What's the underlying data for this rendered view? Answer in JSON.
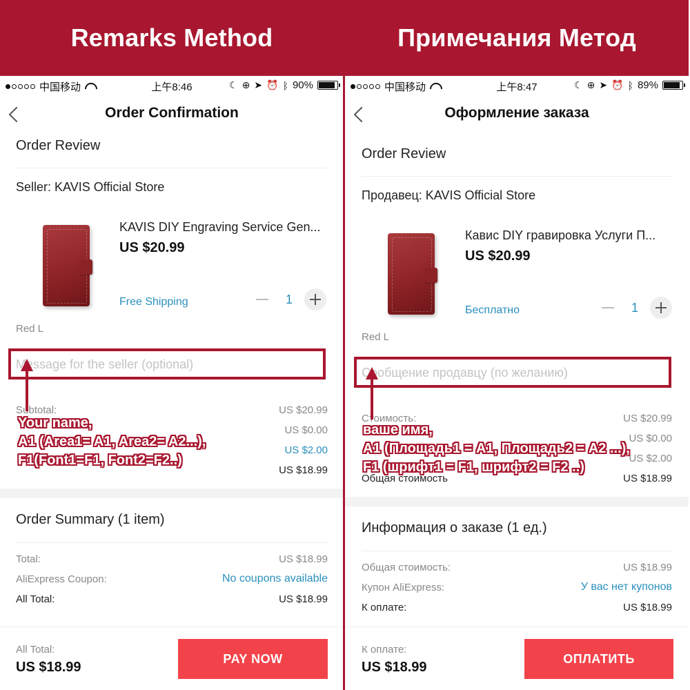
{
  "panels": {
    "left": {
      "banner": "Remarks Method",
      "status": {
        "carrier": "中国移动",
        "time": "上午8:46",
        "battery": "90%",
        "battery_level": 0.9
      },
      "nav_title": "Order Confirmation",
      "order_review": "Order Review",
      "seller_line": "Seller:  KAVIS Official Store",
      "product": {
        "name": "KAVIS DIY Engraving Service Gen...",
        "price": "US $20.99",
        "shipping": "Free Shipping",
        "quantity": "1",
        "variant": "Red L"
      },
      "message_placeholder": "Message for the seller (optional)",
      "costs": [
        {
          "label": "Subtotal:",
          "value": "US $20.99",
          "style": "grey"
        },
        {
          "label": "",
          "value": "US $0.00",
          "style": "grey"
        },
        {
          "label": "",
          "value": "US $2.00",
          "style": "blue"
        },
        {
          "label": "",
          "value": "US $18.99",
          "style": "dark"
        }
      ],
      "annotation": [
        "Your name,",
        "A1  (Area1= A1, Area2= A2...),",
        "F1(Font1=F1, Font2=F2..)"
      ],
      "summary_title": "Order Summary (1 item)",
      "summary": {
        "total_label": "Total:",
        "total_value": "US $18.99",
        "coupon_label": "AliExpress Coupon:",
        "coupon_value": "No coupons available",
        "all_total_label": "All Total:",
        "all_total_value": "US $18.99"
      },
      "bottom": {
        "label": "All Total:",
        "total": "US $18.99",
        "pay_button": "PAY NOW"
      }
    },
    "right": {
      "banner": "Примечания Метод",
      "status": {
        "carrier": "中国移动",
        "time": "上午8:47",
        "battery": "89%",
        "battery_level": 0.89
      },
      "nav_title": "Оформление заказа",
      "order_review": "Order Review",
      "seller_line": "Продавец: KAVIS Official Store",
      "product": {
        "name": "Кавис DIY гравировка Услуги П...",
        "price": "US $20.99",
        "shipping": "Бесплатно",
        "quantity": "1",
        "variant": "Red L"
      },
      "message_placeholder": "Сообщение продавцу (по желанию)",
      "costs": [
        {
          "label": "Стоимость:",
          "value": "US $20.99",
          "style": "grey"
        },
        {
          "label": "",
          "value": "US $0.00",
          "style": "grey"
        },
        {
          "label": "",
          "value": "US $2.00",
          "style": "grey"
        },
        {
          "label": "Общая стоимость",
          "value": "US $18.99",
          "style": "dark"
        }
      ],
      "annotation": [
        "ваше имя,",
        "A1 (Площадь1 = A1, Площадь2 = A2 ...),",
        "F1 (шрифт1 = F1, шрифт2 = F2 ..)"
      ],
      "summary_title": "Информация о заказе (1 ед.)",
      "summary": {
        "total_label": "Общая стоимость:",
        "total_value": "US $18.99",
        "coupon_label": "Купон AliExpress:",
        "coupon_value": "У вас нет купонов",
        "all_total_label": "К оплате:",
        "all_total_value": "US $18.99"
      },
      "bottom": {
        "label": "К оплате:",
        "total": "US $18.99",
        "pay_button": "ОПЛАТИТЬ"
      }
    }
  },
  "colors": {
    "brand_red": "#a8172f",
    "pay_button": "#f3434a",
    "link_blue": "#2a8fbd"
  }
}
